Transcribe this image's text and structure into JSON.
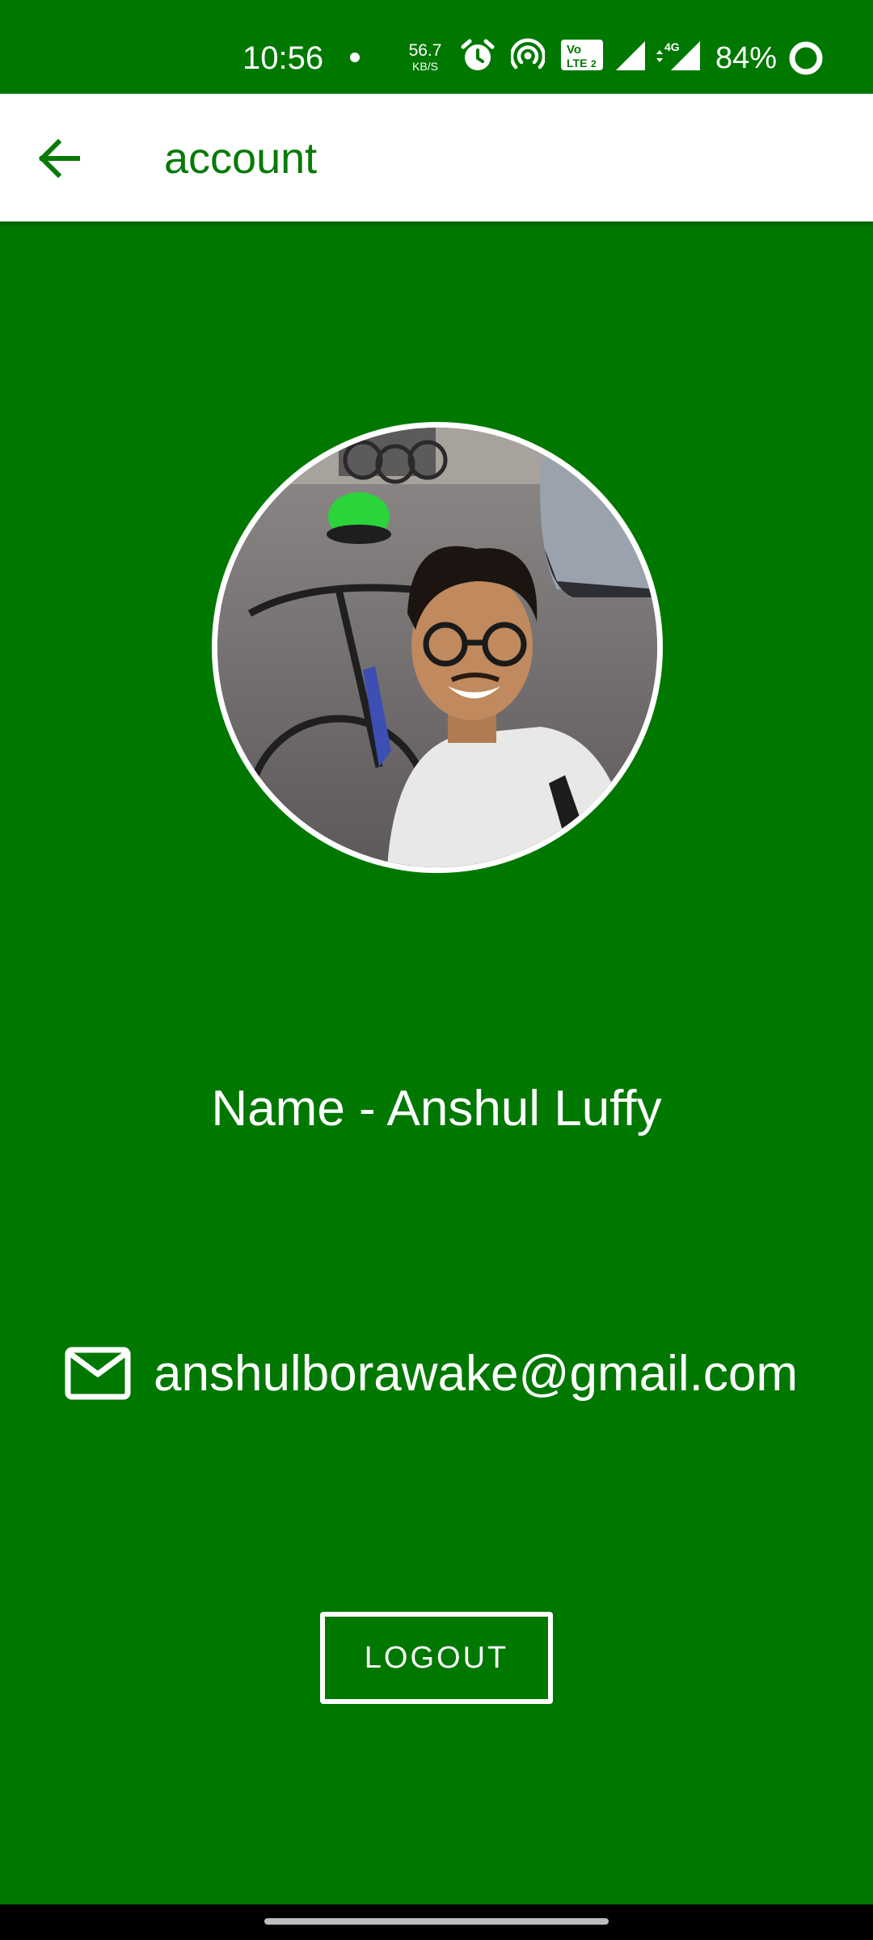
{
  "status_bar": {
    "time": "10:56",
    "net_speed_value": "56.7",
    "net_speed_unit": "KB/S",
    "battery_percent": "84%",
    "icons": [
      "notification-dot",
      "alarm-icon",
      "hotspot-icon",
      "volte-icon",
      "signal-icon",
      "signal-4g-icon",
      "battery-icon"
    ]
  },
  "app_bar": {
    "back_icon": "arrow-left-icon",
    "title": "account"
  },
  "profile": {
    "avatar": "profile-photo",
    "name_line": "Name - Anshul Luffy",
    "email_icon": "mail-icon",
    "email": "anshulborawake@gmail.com"
  },
  "actions": {
    "logout_label": "LOGOUT"
  },
  "colors": {
    "background": "#007800",
    "app_bar": "#ffffff",
    "accent": "#087a08",
    "text_on_primary": "#ffffff"
  }
}
